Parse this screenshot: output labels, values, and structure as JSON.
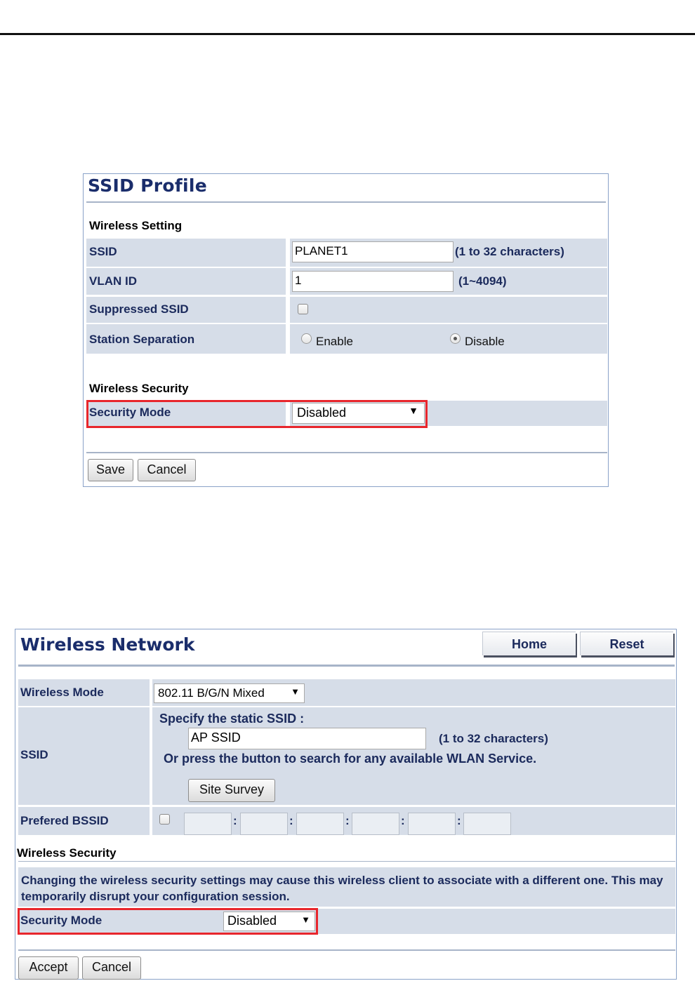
{
  "ssid_profile": {
    "title": "SSID Profile",
    "wireless_setting_label": "Wireless Setting",
    "ssid_label": "SSID",
    "ssid_value": "PLANET1",
    "ssid_hint": "(1 to 32 characters)",
    "vlan_label": "VLAN ID",
    "vlan_value": "1",
    "vlan_hint": "(1~4094)",
    "suppressed_label": "Suppressed SSID",
    "suppressed_checked": false,
    "station_sep_label": "Station Separation",
    "enable_label": "Enable",
    "disable_label": "Disable",
    "station_sep_selected": "Disable",
    "wireless_security_label": "Wireless Security",
    "security_mode_label": "Security Mode",
    "security_mode_value": "Disabled",
    "save_label": "Save",
    "cancel_label": "Cancel"
  },
  "wireless_network": {
    "title": "Wireless Network",
    "home_label": "Home",
    "reset_label": "Reset",
    "mode_label": "Wireless Mode",
    "mode_value": "802.11 B/G/N Mixed",
    "ssid_label": "SSID",
    "specify_label": "Specify the static SSID  :",
    "ssid_value": "AP SSID",
    "ssid_hint": "(1 to 32 characters)",
    "press_text": "Or press the button to search for any available WLAN Service.",
    "site_survey_label": "Site Survey",
    "bssid_label": "Prefered BSSID",
    "bssid_checked": false,
    "bssid_fields": [
      "",
      "",
      "",
      "",
      "",
      ""
    ],
    "wireless_security_label": "Wireless Security",
    "warning_text": "Changing the wireless security settings may cause this wireless client to associate with a different one. This may temporarily disrupt your configuration session.",
    "security_mode_label": "Security Mode",
    "security_mode_value": "Disabled",
    "accept_label": "Accept",
    "cancel_label": "Cancel"
  },
  "colors": {
    "title": "#1a2d6b",
    "label": "#1b2a5c",
    "row_bg": "#d6dde8",
    "highlight": "#e8262c"
  }
}
